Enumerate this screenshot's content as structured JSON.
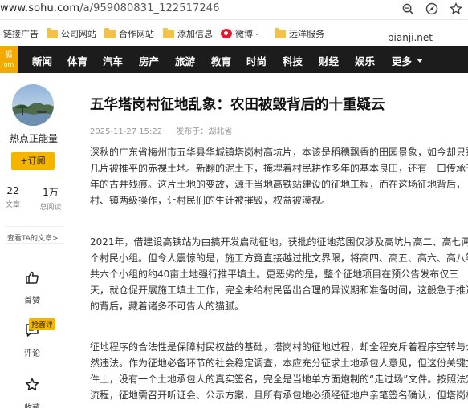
{
  "browser": {
    "url_prefix": "www.sohu.com",
    "url_path": "/a/959080831_122517246",
    "bookmarks": [
      {
        "label": "链接广告",
        "type": "text"
      },
      {
        "label": "公司网站",
        "type": "folder"
      },
      {
        "label": "合作网站",
        "type": "folder"
      },
      {
        "label": "添加信息",
        "type": "folder"
      },
      {
        "label": "微博 -",
        "type": "weibo"
      },
      {
        "label": "远洋服务",
        "type": "folder"
      }
    ],
    "extra_label": "bianji.net"
  },
  "nav": {
    "logo": "狐\nm",
    "items": [
      "新闻",
      "体育",
      "汽车",
      "房产",
      "旅游",
      "教育",
      "时尚",
      "科技",
      "财经",
      "娱乐"
    ],
    "more": "更多"
  },
  "sidebar": {
    "author": "热点正能量",
    "follow": "+订阅",
    "stats": [
      {
        "num": "22",
        "label": "文章"
      },
      {
        "num": "1万",
        "label": "总阅读"
      }
    ],
    "see_all": "查看TA的文章>",
    "actions": [
      {
        "label": "首赞",
        "icon": "thumbs-up-icon"
      },
      {
        "label": "评论",
        "icon": "comment-icon",
        "badge": "抢首评"
      },
      {
        "label": "收藏",
        "icon": "star-icon"
      }
    ]
  },
  "article": {
    "title": "五华塔岗村征地乱象：农田被毁背后的十重疑云",
    "date": "2025-11-27 15:22",
    "source": "发布于：湖北省",
    "paragraphs": [
      [
        "深秋的广东省梅州市五华县华城镇塔岗村高坑片，本该是稻穗飘香的田园景象，如今却只剩",
        "几片被推平的赤裸土地。新翻的泥土下，掩埋着村民耕作多年的基本良田，还有一口传承千",
        "年的古井残痕。这片土地的变故，源于当地高铁站建设的征地工程，而在这场征地背后，",
        "村、镇两级操作，让村民们的生计被摧毁，权益被漠视。"
      ],
      [
        "2021年，借建设高铁站为由搞开发启动征地，获批的征地范围仅涉及高坑片高二、高七两",
        "个村民小组。但令人震惊的是，施工方竟直接越过批文界限，将高四、高五、高六、高八等",
        "共六个小组的约40亩土地强行推平填土。更恶劣的是，整个征地项目在预公告发布仅三",
        "天，就仓促开展施工填土工作，完全未给村民留出合理的异议期和准备时间，这般急于推进",
        "的背后，藏着诸多不可告人的猫腻。"
      ],
      [
        "征地程序的合法性是保障村民权益的基础，塔岗村的征地过程，却全程充斥着程序空转与公",
        "然违法。作为征地必备环节的社会稳定调查，本应充分征求土地承包人意见，但这份关键文",
        "件上，没有一个土地承包人的真实签名，完全是当地单方面炮制的“走过场”文件。按照法定",
        "流程，征地需召开听证会、公示方案，且所有承包地必须经征地户亲笔签名确认，但塔岗村"
      ]
    ]
  }
}
